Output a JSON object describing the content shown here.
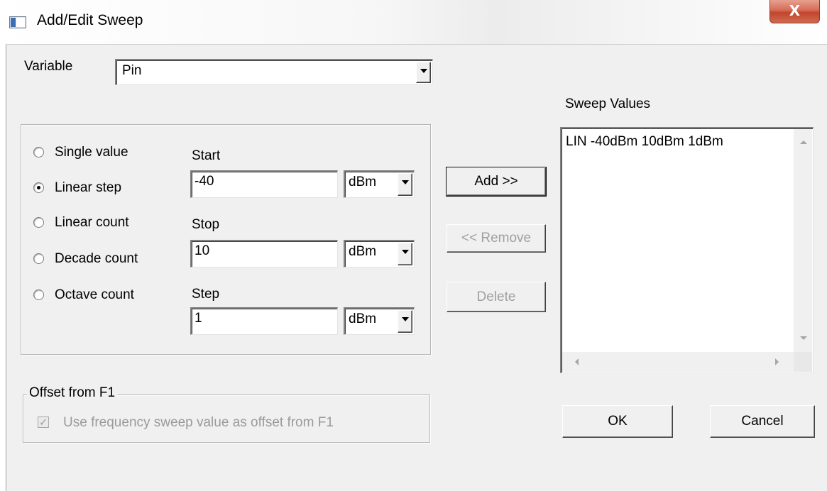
{
  "window": {
    "title": "Add/Edit Sweep",
    "close_glyph": "X"
  },
  "variable": {
    "label": "Variable",
    "value": "Pin"
  },
  "sweep_types": [
    {
      "label": "Single value",
      "checked": false
    },
    {
      "label": "Linear step",
      "checked": true
    },
    {
      "label": "Linear count",
      "checked": false
    },
    {
      "label": "Decade count",
      "checked": false
    },
    {
      "label": "Octave count",
      "checked": false
    }
  ],
  "start": {
    "label": "Start",
    "value": "-40",
    "unit": "dBm"
  },
  "stop": {
    "label": "Stop",
    "value": "10",
    "unit": "dBm"
  },
  "step": {
    "label": "Step",
    "value": "1",
    "unit": "dBm"
  },
  "buttons": {
    "add": "Add >>",
    "remove": "<< Remove",
    "delete": "Delete",
    "ok": "OK",
    "cancel": "Cancel"
  },
  "sweep_values": {
    "label": "Sweep Values",
    "items": [
      "LIN -40dBm 10dBm 1dBm"
    ]
  },
  "offset": {
    "group_label": "Offset from F1",
    "checkbox_label": "Use frequency sweep value as offset from F1",
    "checked": true,
    "enabled": false
  },
  "icons": {
    "check_glyph": "✓"
  }
}
